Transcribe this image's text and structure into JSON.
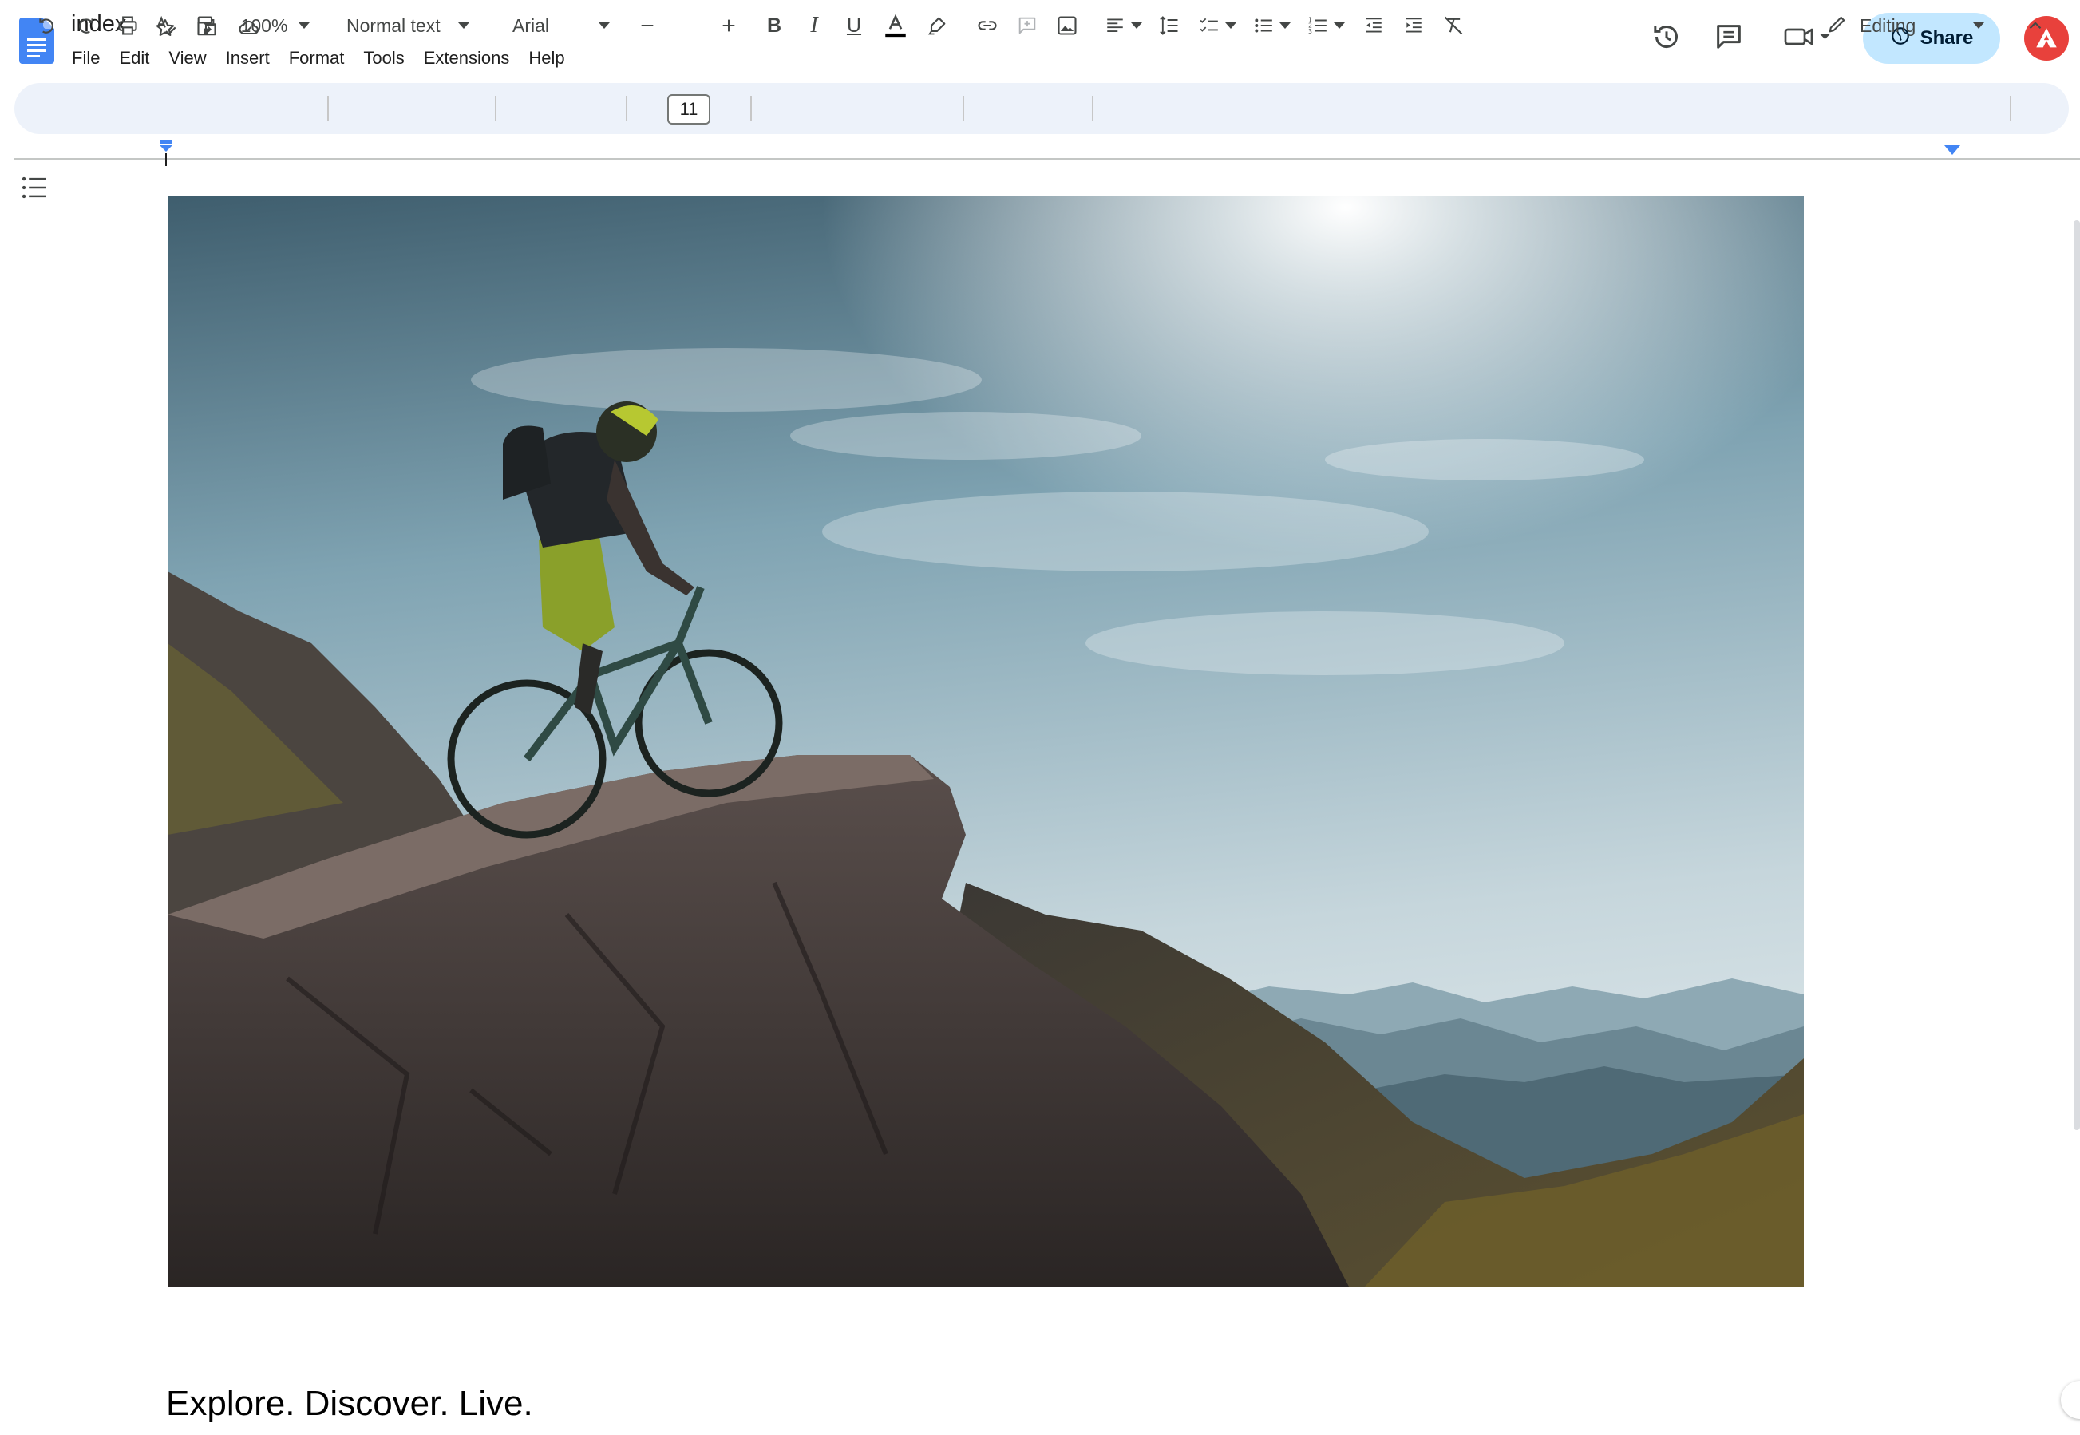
{
  "document": {
    "title": "index",
    "body_text": "Explore. Discover. Live."
  },
  "menu": {
    "items": [
      "File",
      "Edit",
      "View",
      "Insert",
      "Format",
      "Tools",
      "Extensions",
      "Help"
    ]
  },
  "header": {
    "share_label": "Share"
  },
  "toolbar": {
    "zoom": "100%",
    "paragraph_style": "Normal text",
    "font": "Arial",
    "font_size": "11",
    "mode": "Editing",
    "text_color": "#000000"
  },
  "colors": {
    "share_bg": "#c2e7ff",
    "toolbar_bg": "#edf2fa",
    "brand_blue": "#4285f4",
    "avatar_red": "#e8413c",
    "ruler_marker": "#4285f4"
  },
  "icons": {
    "title": [
      "star-icon",
      "move-to-folder-icon",
      "cloud-saved-icon"
    ],
    "header": [
      "version-history-icon",
      "comments-icon",
      "meet-camera-icon",
      "globe-icon",
      "account-avatar"
    ],
    "toolbar": [
      "undo-icon",
      "redo-icon",
      "print-icon",
      "spellcheck-icon",
      "paint-format-icon",
      "decrease-font-icon",
      "increase-font-icon",
      "bold-icon",
      "italic-icon",
      "underline-icon",
      "text-color-icon",
      "highlight-icon",
      "link-icon",
      "add-comment-icon",
      "insert-image-icon",
      "align-left-icon",
      "line-spacing-icon",
      "checklist-icon",
      "bulleted-list-icon",
      "numbered-list-icon",
      "decrease-indent-icon",
      "increase-indent-icon",
      "clear-formatting-icon",
      "pencil-icon",
      "collapse-menus-icon"
    ],
    "side": [
      "document-outline-icon"
    ]
  },
  "image": {
    "subject": "mountain-biker-on-cliff-photo"
  }
}
